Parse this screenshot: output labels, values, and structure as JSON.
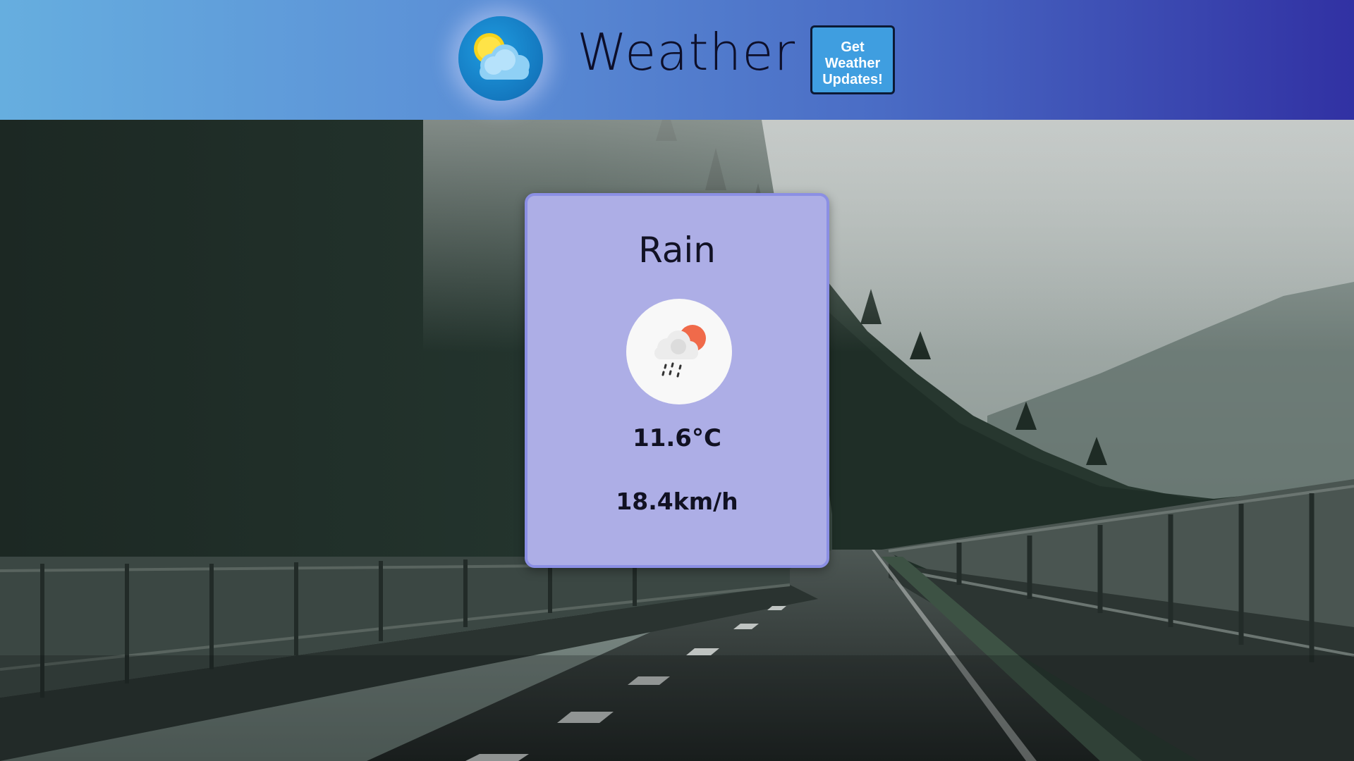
{
  "header": {
    "title": "Weather",
    "logo_icon": "sun-behind-cloud-icon",
    "updates_button_label": "Get Weather Updates!",
    "gradient_start": "#66aedf",
    "gradient_end": "#3131a3"
  },
  "background": {
    "description_icon": "misty-forest-road-photo"
  },
  "weather_card": {
    "condition": "Rain",
    "icon": "rain-cloud-with-sun-icon",
    "temperature": "11.6°C",
    "wind_speed": "18.4km/h",
    "card_color": "#adaee6",
    "border_color": "#8b8fe4"
  }
}
